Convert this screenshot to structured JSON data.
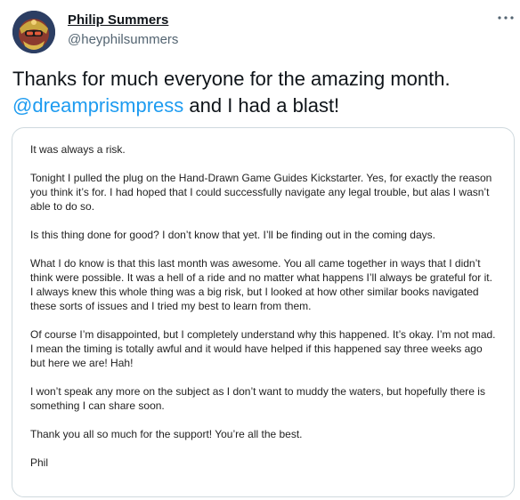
{
  "author": {
    "display_name": "Philip Summers",
    "handle": "@heyphilsummers"
  },
  "tweet": {
    "text_before_mention": "Thanks for much everyone for the amazing month.",
    "mention": "@dreamprismpress",
    "text_after_mention": " and I had a blast!"
  },
  "letter": {
    "paragraphs": [
      "It was always a risk.",
      "Tonight I pulled the plug on the Hand-Drawn Game Guides Kickstarter. Yes, for exactly the reason you think it’s for. I had hoped that I could successfully navigate any legal trouble, but alas I wasn’t able to do so.",
      "Is this thing done for good? I don’t know that yet. I’ll be finding out in the coming days.",
      "What I do know is that this last month was awesome. You all came together in ways that I didn’t think were possible. It was a hell of a ride and no matter what happens I’ll always be grateful for it. I always knew this whole thing was a big risk, but I looked at how other similar books navigated these sorts of issues and I tried my best to learn from them.",
      "Of course I’m disappointed, but I completely understand why this happened. It’s okay. I’m not mad. I mean the timing is totally awful and it would have helped if this happened say three weeks ago but here we are! Hah!",
      "I won’t speak any more on the subject as I don’t want to muddy the waters, but hopefully there is something I can share soon.",
      "Thank you all so much for the support! You’re all the best.",
      "Phil"
    ]
  },
  "icons": {
    "more": "more-options-icon",
    "avatar": "avatar-image"
  },
  "colors": {
    "mention": "#1d9bf0",
    "handle": "#536471",
    "text": "#0f1419",
    "border": "#cfd9de"
  }
}
